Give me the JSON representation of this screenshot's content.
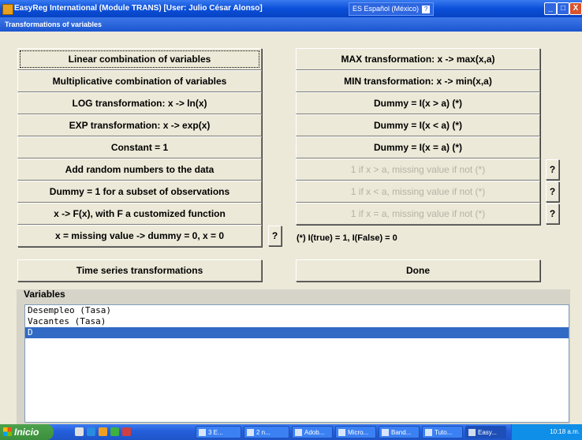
{
  "window": {
    "title": "EasyReg International (Module TRANS) [User: Julio César Alonso]",
    "language": "ES Español (México)",
    "language_help": "?",
    "minimize": "_",
    "maximize": "□",
    "close": "X"
  },
  "form": {
    "title": "Transformations of variables"
  },
  "left_buttons": [
    "Linear combination of variables",
    "Multiplicative combination of variables",
    "LOG transformation: x -> ln(x)",
    "EXP transformation: x -> exp(x)",
    "Constant  = 1",
    "Add random numbers to the data",
    "Dummy = 1 for a subset of observations",
    "x -> F(x), with F a customized function",
    "x = missing value -> dummy = 0, x = 0"
  ],
  "right_buttons": [
    "MAX transformation: x -> max(x,a)",
    "MIN transformation: x -> min(x,a)",
    "Dummy =  I(x > a)  (*)",
    "Dummy = I(x < a)  (*)",
    "Dummy = I(x = a) (*)",
    "1 if x > a, missing value if not (*)",
    "1 if x < a, missing value if not (*)",
    "1 if x = a, missing value if not (*)"
  ],
  "help_label": "?",
  "note": "(*) I(true) = 1, I(False) = 0",
  "time_series_button": "Time series transformations",
  "done_button": "Done",
  "variables": {
    "label": "Variables",
    "items": [
      "Desempleo (Tasa)",
      "Vacantes (Tasa)",
      "D"
    ],
    "selected_index": 2
  },
  "taskbar": {
    "start": "Inicio",
    "tasks": [
      "3 E...",
      "2 n...",
      "Adob...",
      "Micro...",
      "Band...",
      "Tuto...",
      "Easy..."
    ],
    "clock": "10:18 a.m."
  },
  "colors": {
    "titlebar": "#0a4fd8",
    "face": "#ece9d8",
    "selection": "#316ac5",
    "disabled_text": "#b5b2a6"
  }
}
